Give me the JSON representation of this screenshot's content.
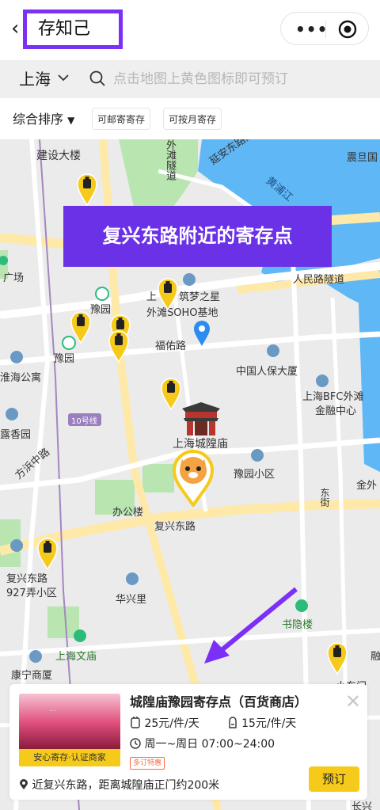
{
  "header": {
    "back_glyph": "‹",
    "title": "存知己"
  },
  "capsule": {
    "more_icon": "more-dots-icon",
    "close_icon": "target-icon"
  },
  "search": {
    "city": "上海",
    "placeholder": "点击地图上黄色图标即可预订"
  },
  "filters": {
    "sort_label": "综合排序",
    "sort_arrow": "▼",
    "chips": [
      "可邮寄寄存",
      "可按月寄存"
    ]
  },
  "banner": {
    "text": "复兴东路附近的寄存点"
  },
  "map_labels": {
    "jianshe": "建设大楼",
    "waitan_qu": "外滩隧道",
    "yanan_tunnel": "延安东路隧道",
    "zhendan": "震旦国",
    "huangpu_river": "黄浦江",
    "renmin_tunnel": "人民路隧道",
    "guangchang": "广场",
    "yuyuan_1": "豫园",
    "yuyuan_2": "豫园",
    "zhumeng": "筑梦之星",
    "waitan_soho": "外滩SOHO基地",
    "shang": "上",
    "fuyou": "福佑路",
    "renbao": "中国人保大厦",
    "huaihai": "淮海公寓",
    "bfc_1": "上海BFC外滩",
    "bfc_2": "金融中心",
    "line10": "10号线",
    "xiangyuan": "露香园",
    "chenghuang": "上海城隍庙",
    "yuyuan_xq": "豫园小区",
    "fangbang": "方浜中路",
    "jinwai": "金外",
    "dongjie": "东街",
    "bangonglou": "办公楼",
    "fuxing_road": "复兴东路",
    "fuxing_927_1": "复兴东路",
    "fuxing_927_2": "927弄小区",
    "huaxingli": "华兴里",
    "shuyin": "书隐楼",
    "wenmiao": "上海文庙",
    "kangning": "康宁商厦",
    "xiaodongmen": "小东门",
    "changxing": "长兴",
    "rong": "融"
  },
  "card": {
    "title": "城隍庙豫园寄存点（百货商店）",
    "thumb_text": "...",
    "thumb_tag": "安心寄存·认证商家",
    "price_bag": "25元/件/天",
    "price_backpack": "15元/件/天",
    "hours": "周一~周日 07:00~24:00",
    "discount": "多订特惠",
    "address": "近复兴东路，距离城隍庙正门约200米",
    "book_label": "预订",
    "close_glyph": "✕"
  },
  "colors": {
    "accent": "#7b2ff7",
    "banner": "#6b31e6",
    "marker": "#f6ca1b",
    "water": "#5fb7f5",
    "park": "#b8e5b0"
  }
}
